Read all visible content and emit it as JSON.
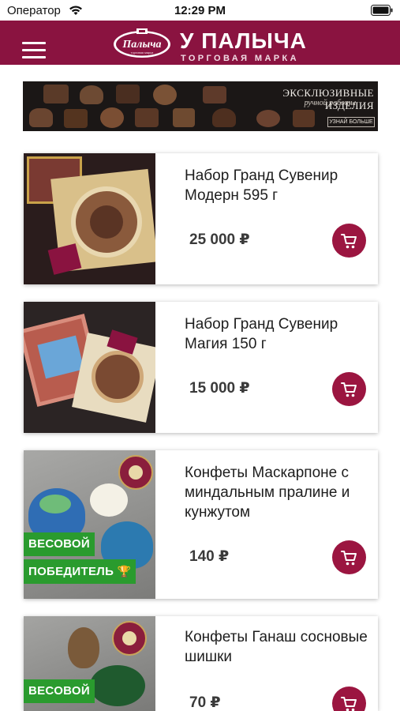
{
  "status_bar": {
    "carrier": "Оператор",
    "time": "12:29 PM"
  },
  "header": {
    "brand_title": "У ПАЛЫЧА",
    "brand_subtitle": "ТОРГОВАЯ МАРКА",
    "logo_script": "Палыча",
    "logo_small": "торговая марка"
  },
  "promo": {
    "title": "ЭКСКЛЮЗИВНЫЕ ИЗДЕЛИЯ",
    "subtitle": "ручной работы",
    "button": "УЗНАЙ БОЛЬШЕ"
  },
  "products": [
    {
      "name": "Набор Гранд Сувенир Модерн 595 г",
      "price": "25 000 ₽"
    },
    {
      "name": "Набор Гранд Сувенир Магия 150 г",
      "price": "15 000 ₽"
    },
    {
      "name": "Конфеты Маскарпоне с миндальным пралине и кунжутом",
      "price": "140 ₽",
      "badge_line1": "ВЕСОВОЙ",
      "badge_line2": "ПОБЕДИТЕЛЬ",
      "badge_trophy": "🏆"
    },
    {
      "name": "Конфеты Ганаш сосновые шишки",
      "price": "70 ₽",
      "badge_line1": "ВЕСОВОЙ"
    }
  ],
  "colors": {
    "brand": "#8a1340",
    "cart_button": "#9b1540",
    "badge": "#2a9b2e"
  },
  "icons": [
    "wifi-icon",
    "battery-icon",
    "menu-icon",
    "cart-icon",
    "trophy-icon"
  ]
}
